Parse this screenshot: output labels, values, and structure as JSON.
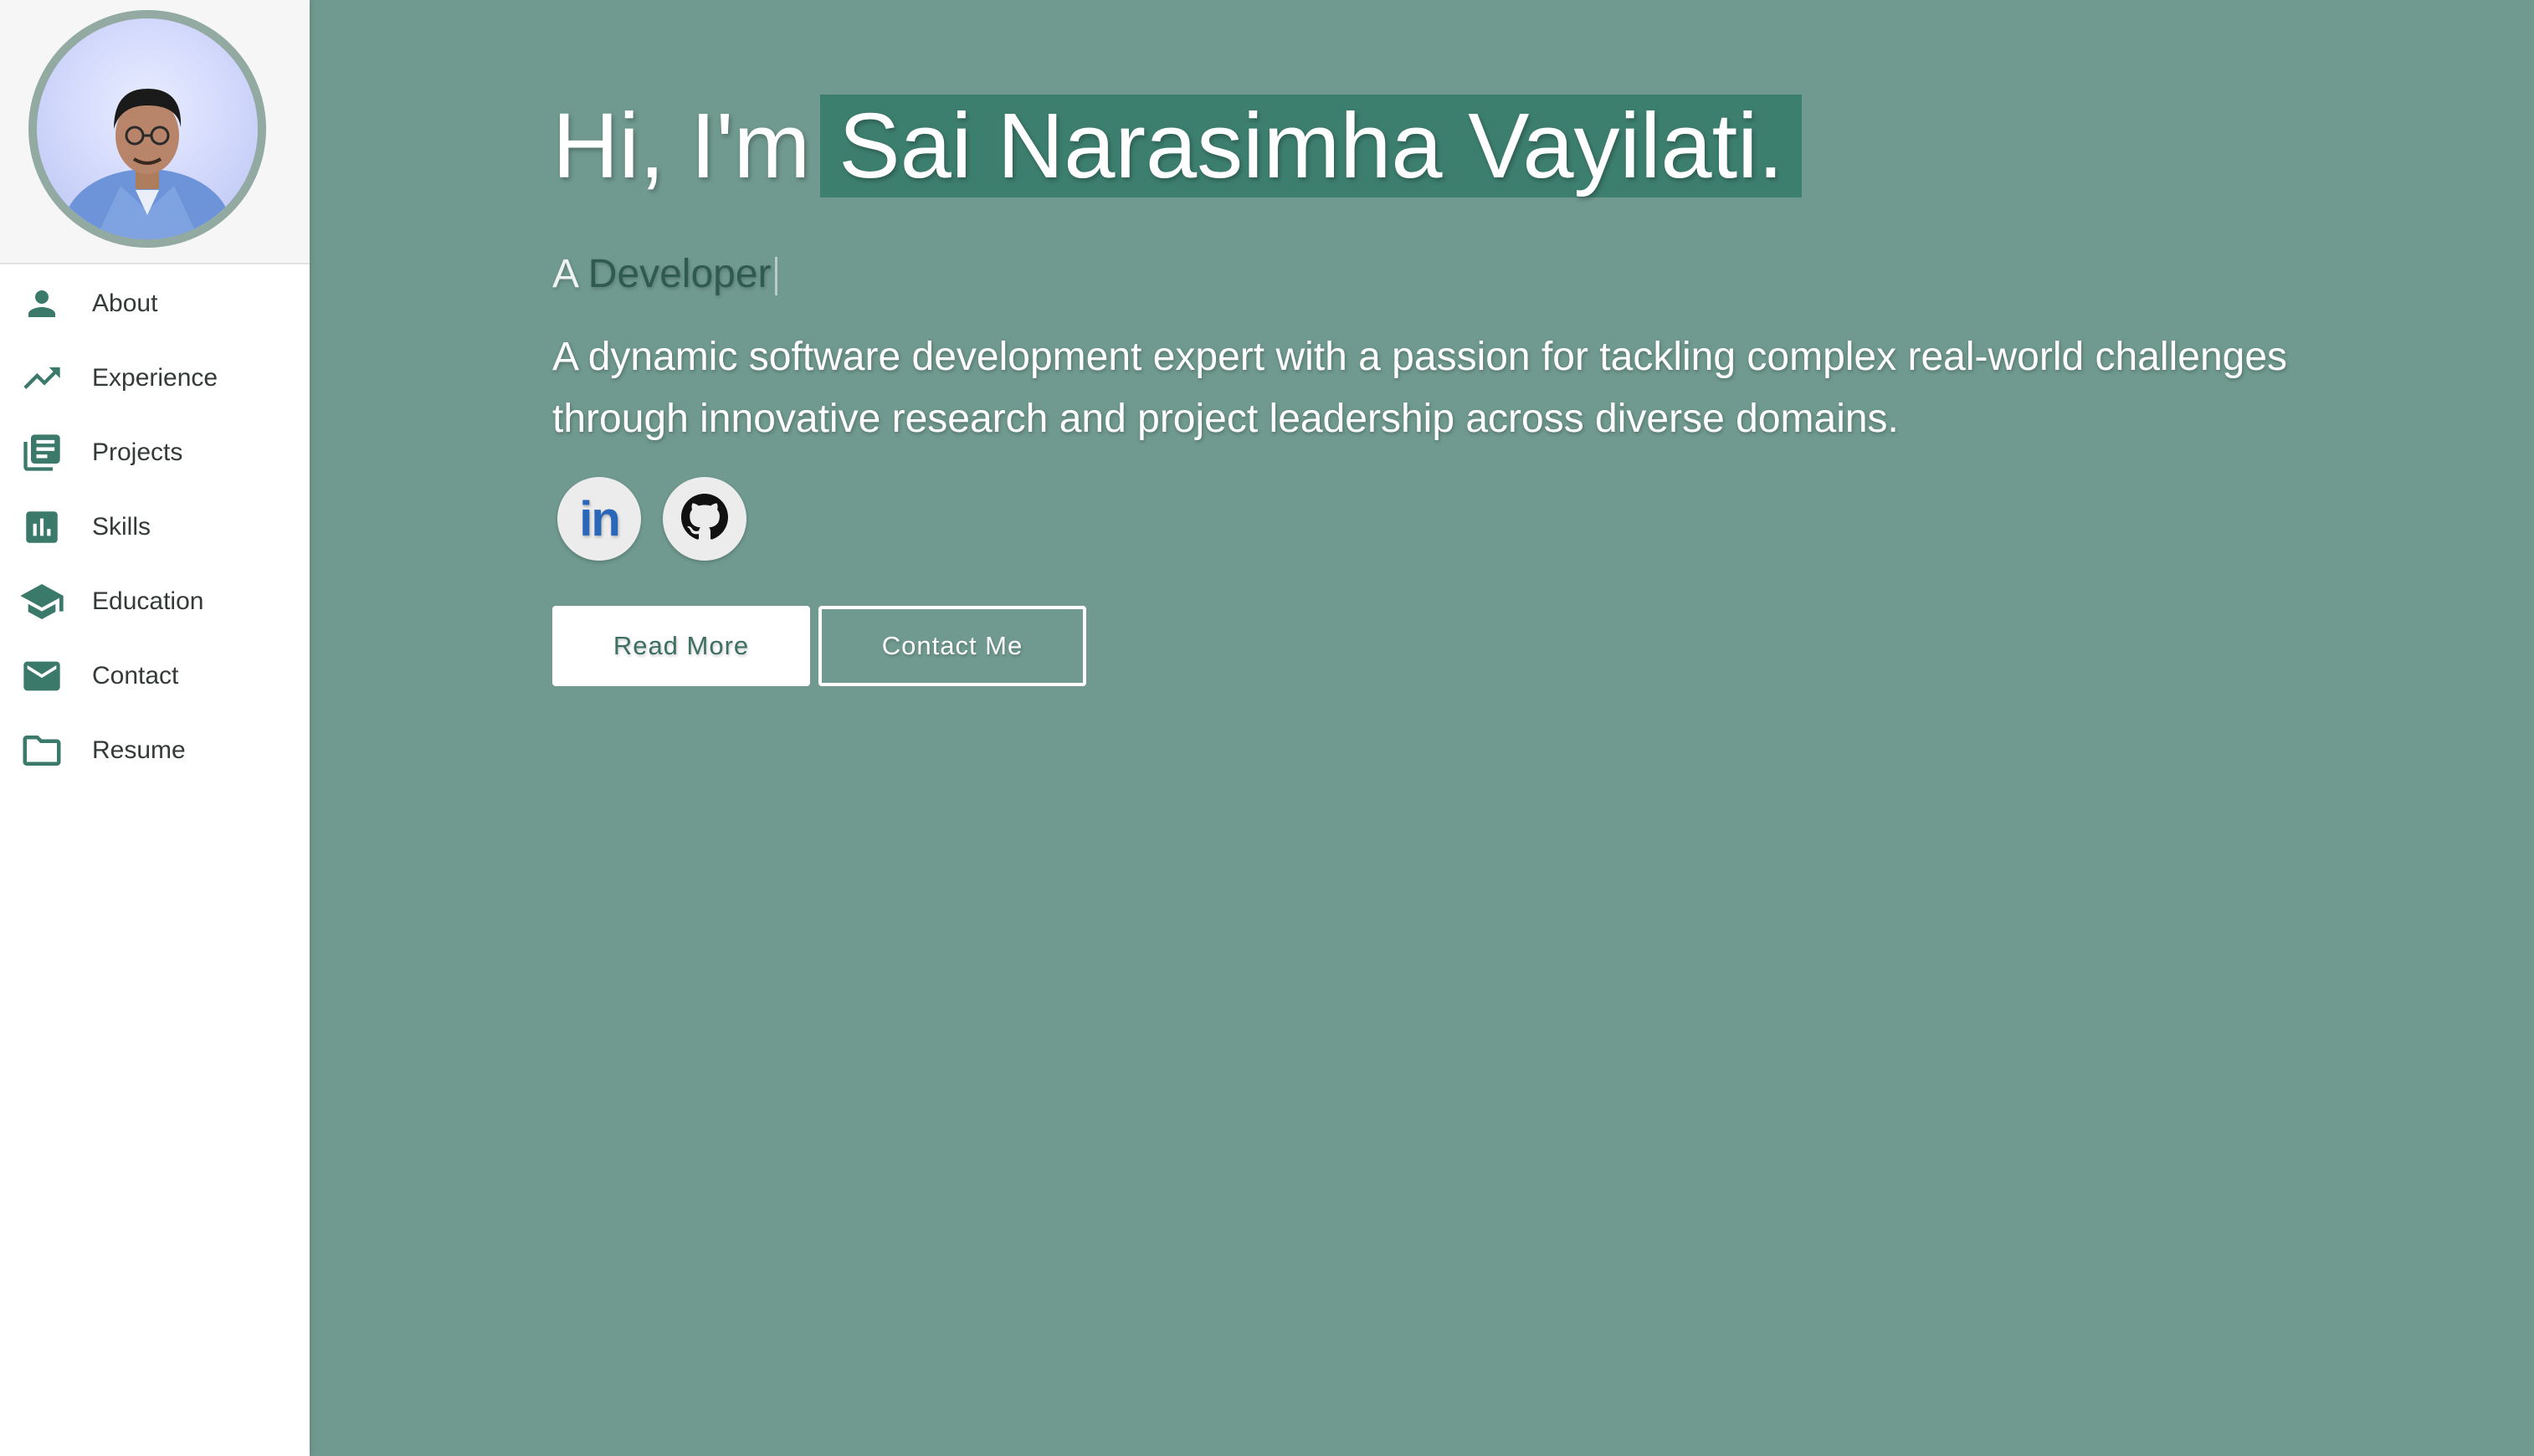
{
  "profile": {
    "avatar_alt": "Profile photo"
  },
  "sidebar": {
    "items": [
      {
        "label": "About",
        "icon": "person-icon"
      },
      {
        "label": "Experience",
        "icon": "trending-up-icon"
      },
      {
        "label": "Projects",
        "icon": "article-icon"
      },
      {
        "label": "Skills",
        "icon": "bar-chart-icon"
      },
      {
        "label": "Education",
        "icon": "graduation-cap-icon"
      },
      {
        "label": "Contact",
        "icon": "mail-icon"
      },
      {
        "label": "Resume",
        "icon": "folder-icon"
      }
    ]
  },
  "hero": {
    "greeting": "Hi, I'm",
    "name": "Sai Narasimha Vayilati.",
    "role_prefix": "A",
    "role_word": "Developer",
    "description": "A dynamic software development expert with a passion for tackling complex real-world challenges through innovative research and project leadership across diverse domains.",
    "socials": [
      {
        "name": "LinkedIn",
        "icon": "linkedin-icon",
        "text": "in"
      },
      {
        "name": "GitHub",
        "icon": "github-icon"
      }
    ],
    "read_more_label": "Read More",
    "contact_label": "Contact Me"
  },
  "colors": {
    "background": "#709a8f",
    "accent": "#3d7f6f",
    "sidebar_icon": "#3b7a6b",
    "sidebar_bg": "#ffffff"
  }
}
